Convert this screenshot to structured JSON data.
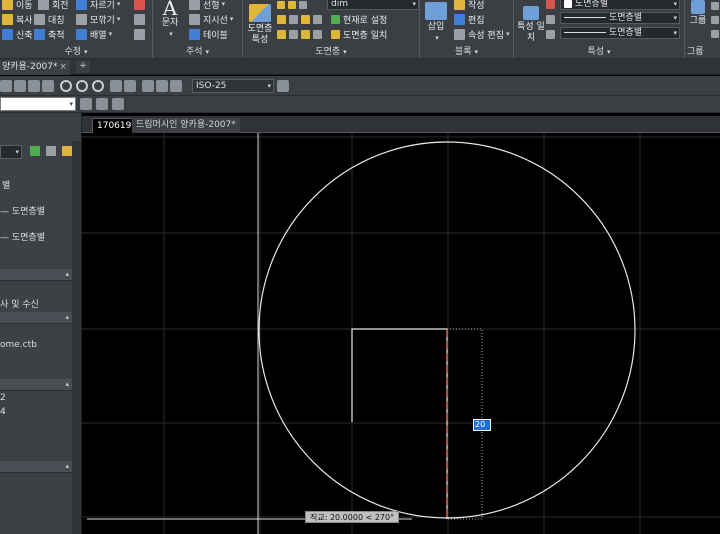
{
  "ribbon": {
    "modify": {
      "title": "수정",
      "items": [
        "이동",
        "회전",
        "자르기",
        "복사",
        "대칭",
        "모깎기",
        "신축",
        "축척",
        "배열"
      ]
    },
    "annotation": {
      "title": "주석",
      "text_label": "문자",
      "items": [
        "선형",
        "지시선",
        "테이블"
      ]
    },
    "layers": {
      "title": "도면층",
      "properties_label": "도면층 특성",
      "layer_value": "dim",
      "items": [
        "현재로 설정",
        "도면층 일치"
      ]
    },
    "block": {
      "title": "블록",
      "insert_label": "삽입",
      "items": [
        "작성",
        "편집",
        "속성 편집"
      ]
    },
    "properties": {
      "title": "특성",
      "match_label": "특성 일치",
      "color_value": "도면층별",
      "linetype_value": "도면층별",
      "lineweight_value": "도면층별"
    },
    "groups": {
      "title": "그룹",
      "label": "그룹"
    }
  },
  "file_tab": {
    "label": "양카용-2007*",
    "close": "×",
    "new_tab": "+"
  },
  "toolbar": {
    "dimstyle": "ISO-25"
  },
  "palette": {
    "rows": [
      "별",
      "도면층별",
      "도면층별",
      "사 및 수신",
      "ome.ctb",
      "2",
      "4"
    ]
  },
  "drawing_tabs": [
    "170619*",
    "드림머시인 양카용-2007*"
  ],
  "canvas": {
    "dynamic_input": "20",
    "tooltip": "직교: 20.0000 < 270°"
  },
  "colors": {
    "ribbon_bg": "#3b3f44",
    "canvas_bg": "#000000",
    "tracking_line": "#e8643c",
    "geometry": "#ffffff"
  }
}
